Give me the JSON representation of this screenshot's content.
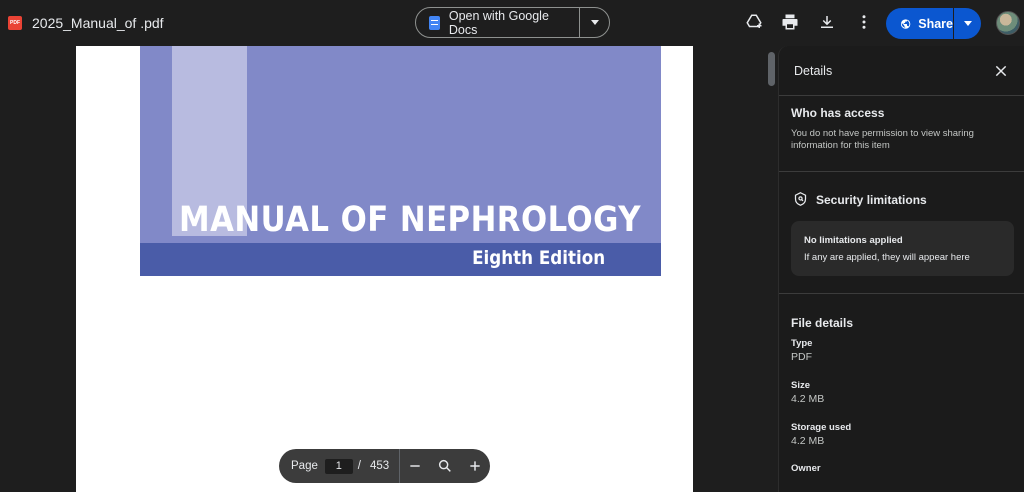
{
  "file": {
    "name": "2025_Manual_of .pdf",
    "badge": "PDF"
  },
  "toolbar": {
    "open_with_label": "Open with Google Docs",
    "share_label": "Share"
  },
  "cover": {
    "title": "MANUAL OF NEPHROLOGY",
    "edition": "Eighth Edition",
    "colors": {
      "main": "#8189c8",
      "strip": "#b8bbe0",
      "band": "#4a5ca8"
    }
  },
  "page_controls": {
    "label": "Page",
    "current": "1",
    "separator": "/",
    "total": "453"
  },
  "details": {
    "title": "Details",
    "access": {
      "heading": "Who has access",
      "text": "You do not have permission to view sharing information for this item"
    },
    "security": {
      "heading": "Security limitations",
      "box_title": "No limitations applied",
      "box_text": "If any are applied, they will appear here"
    },
    "file_details": {
      "heading": "File details",
      "type_label": "Type",
      "type_value": "PDF",
      "size_label": "Size",
      "size_value": "4.2 MB",
      "storage_label": "Storage used",
      "storage_value": "4.2 MB",
      "owner_label": "Owner"
    }
  },
  "icons": {
    "add_shortcut": "add-to-drive-icon",
    "print": "print-icon",
    "download": "download-icon",
    "more": "more-vert-icon",
    "globe": "globe-icon",
    "close": "close-icon",
    "shield": "shield-icon",
    "zoom_out": "minus-icon",
    "zoom": "zoom-icon",
    "zoom_in": "plus-icon"
  },
  "colors": {
    "accent": "#0b57d0",
    "pdf_red": "#ea4335",
    "docs_blue": "#4285f4"
  }
}
